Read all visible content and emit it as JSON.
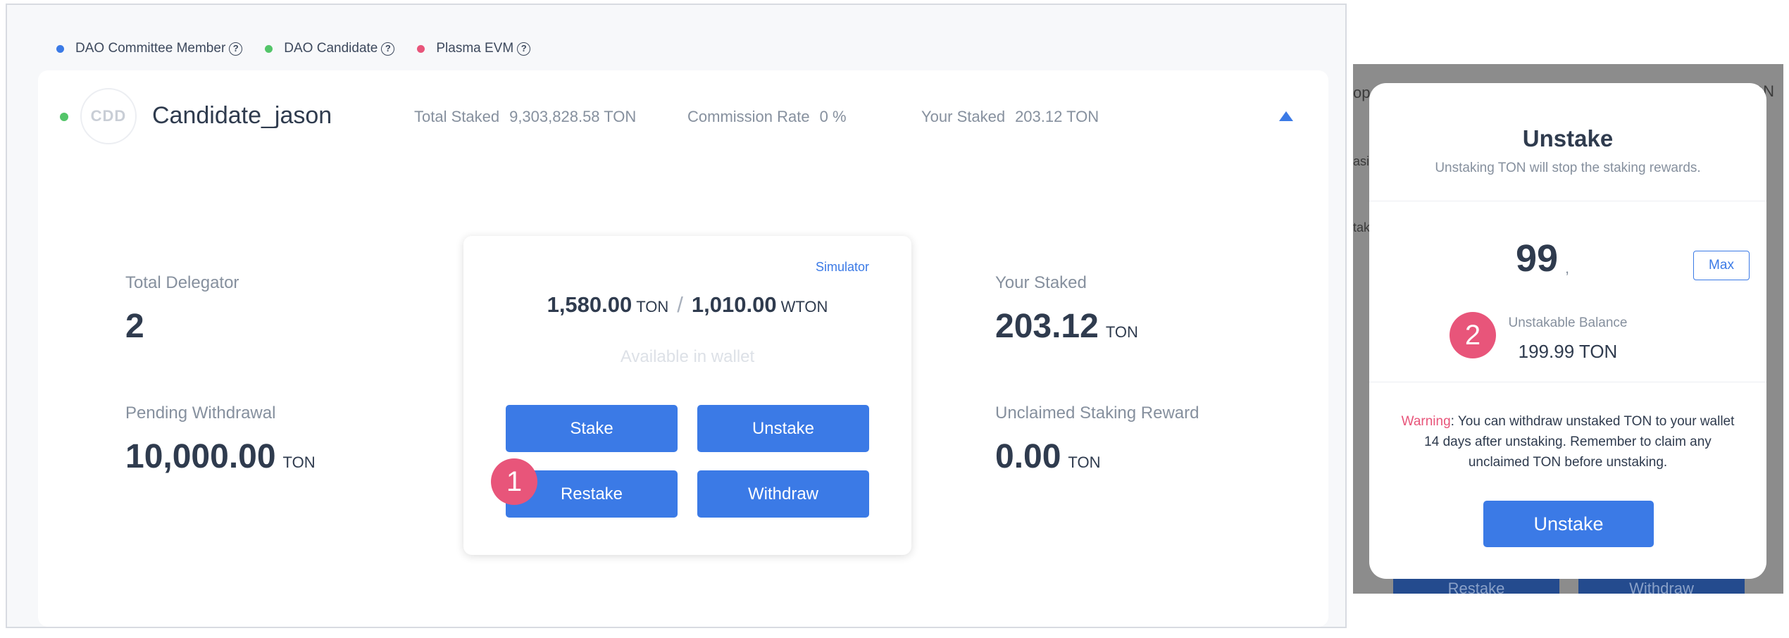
{
  "legend": {
    "items": [
      {
        "label": "DAO Committee Member",
        "color": "#3b7ae6"
      },
      {
        "label": "DAO Candidate",
        "color": "#53c569"
      },
      {
        "label": "Plasma EVM",
        "color": "#e8557a"
      }
    ],
    "help_glyph": "?"
  },
  "candidate": {
    "avatar_text": "CDD",
    "name": "Candidate_jason",
    "total_staked_label": "Total Staked",
    "total_staked_value": "9,303,828.58 TON",
    "commission_label": "Commission Rate",
    "commission_value": "0 %",
    "your_staked_label": "Your Staked",
    "your_staked_value": "203.12 TON"
  },
  "stats": {
    "total_delegator_label": "Total Delegator",
    "total_delegator_value": "2",
    "pending_label": "Pending Withdrawal",
    "pending_value": "10,000.00",
    "pending_unit": "TON",
    "your_staked_label": "Your Staked",
    "your_staked_value": "203.12",
    "your_staked_unit": "TON",
    "unclaimed_label": "Unclaimed Staking Reward",
    "unclaimed_value": "0.00",
    "unclaimed_unit": "TON"
  },
  "actions": {
    "simulator_label": "Simulator",
    "ton_balance": "1,580.00",
    "ton_unit": "TON",
    "separator": "/",
    "wton_balance": "1,010.00",
    "wton_unit": "WTON",
    "available_text": "Available in wallet",
    "stake_label": "Stake",
    "unstake_label": "Unstake",
    "restake_label": "Restake",
    "withdraw_label": "Withdraw"
  },
  "badges": {
    "step1": "1",
    "step2": "2"
  },
  "modal": {
    "title": "Unstake",
    "subtitle": "Unstaking TON will stop the staking rewards.",
    "amount": "99",
    "amount_caret": ",",
    "max_label": "Max",
    "unstakable_label": "Unstakable Balance",
    "unstakable_value": "199.99 TON",
    "warning_prefix": "Warning",
    "warning_body": ": You can withdraw unstaked TON to your wallet 14 days after unstaking. Remember to claim any unclaimed TON before unstaking.",
    "unstake_button": "Unstake"
  },
  "background_fragments": {
    "frag1": "op",
    "frag2": "asi",
    "frag3": "tak",
    "frag4": "ON",
    "btn1": "Restake",
    "btn2": "Withdraw"
  },
  "colors": {
    "accent": "#3b7ae6",
    "candidate_status": "#53c569",
    "badge": "#e8557a",
    "warning": "#e8557a"
  }
}
